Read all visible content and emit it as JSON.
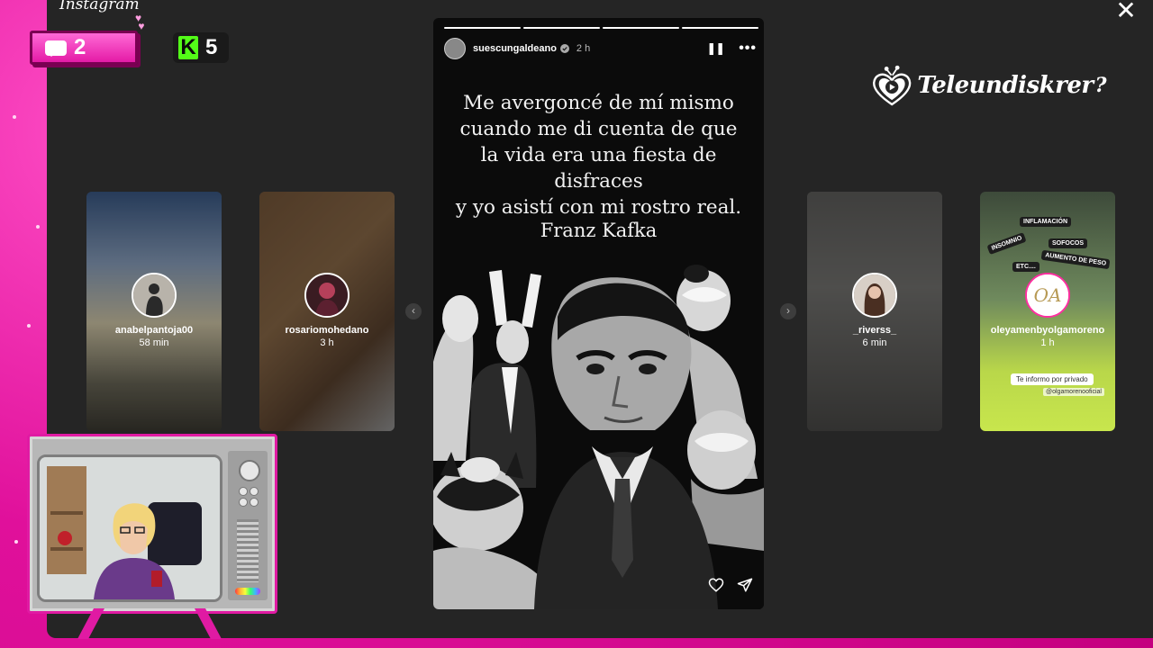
{
  "app": {
    "title": "Instagram"
  },
  "overlay": {
    "chat_count": "2",
    "kick_count": "5",
    "kick_letter": "K",
    "brand_name": "Teleundiskrer",
    "brand_suffix": "?"
  },
  "story": {
    "username": "suescungaldeano",
    "time": "2 h",
    "quote_lines": [
      "Me avergoncé de mí mismo",
      "cuando me di cuenta de que",
      "la vida era una fiesta de disfraces",
      "y yo asistí con mi rostro real."
    ],
    "author": "Franz Kafka",
    "progress_segments": 4,
    "progress_done": 4
  },
  "side_stories": [
    {
      "username": "anabelpantoja00",
      "time": "58 min"
    },
    {
      "username": "rosariomohedano",
      "time": "3 h"
    },
    {
      "username": "_riverss_",
      "time": "6 min"
    },
    {
      "username": "oleyamenbyolgamoreno",
      "time": "1 h"
    }
  ],
  "card4": {
    "stickers": [
      "INFLAMACIÓN",
      "INSOMNIO",
      "SOFOCOS",
      "AUMENTO DE PESO",
      "ETC...."
    ],
    "info_tag": "Te informo por privado",
    "handle_tag": "@olgamorenooficial"
  },
  "colors": {
    "stream_pink": "#e0109b",
    "kick_green": "#53fc18",
    "ig_bg": "#252525"
  },
  "icons": {
    "close": "close-icon",
    "pause": "pause-icon",
    "more": "more-icon",
    "like": "heart-icon",
    "share": "send-icon",
    "nav_prev": "chevron-left-icon",
    "nav_next": "chevron-right-icon"
  }
}
